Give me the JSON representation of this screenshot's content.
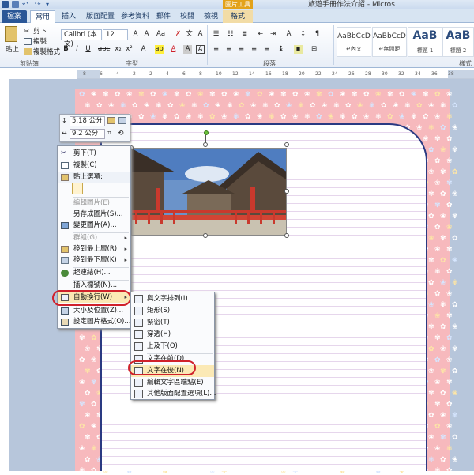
{
  "window": {
    "title": "旅遊手冊作法介紹 - Micros"
  },
  "quick_access": {
    "icons": [
      "word-icon",
      "save-icon",
      "undo-icon",
      "redo-icon",
      "customize-icon"
    ]
  },
  "contextual_tab": {
    "label": "圖片工具"
  },
  "tabs": [
    {
      "label": "檔案"
    },
    {
      "label": "常用"
    },
    {
      "label": "插入"
    },
    {
      "label": "版面配置"
    },
    {
      "label": "參考資料"
    },
    {
      "label": "郵件"
    },
    {
      "label": "校閱"
    },
    {
      "label": "檢視"
    },
    {
      "label": "格式"
    }
  ],
  "ribbon": {
    "clipboard": {
      "paste": "貼上",
      "cut": "剪下",
      "copy": "複製",
      "format_painter": "複製格式",
      "group_label": "剪貼簿"
    },
    "font": {
      "name": "Calibri (本文)",
      "size": "12",
      "group_label": "字型",
      "color_accent": "#d0212b"
    },
    "paragraph": {
      "group_label": "段落"
    },
    "styles": {
      "items": [
        {
          "preview": "AaBbCcD",
          "name": "↵內文"
        },
        {
          "preview": "AaBbCcD",
          "name": "↵無間距"
        },
        {
          "preview": "AaB",
          "name": "標題 1"
        },
        {
          "preview": "AaB",
          "name": "標題 2"
        }
      ],
      "group_label": "樣式"
    }
  },
  "ruler": {
    "marks": [
      "8",
      "6",
      "4",
      "2",
      "2",
      "4",
      "6",
      "8",
      "10",
      "12",
      "14",
      "16",
      "18",
      "20",
      "22",
      "24",
      "26",
      "28",
      "30",
      "32",
      "34",
      "36",
      "38"
    ]
  },
  "mini_toolbar": {
    "height": "5.18 公分",
    "width": "9.2 公分"
  },
  "context_menu": {
    "items": [
      {
        "label": "剪下(T)",
        "icon": "scissors-icon",
        "enabled": true
      },
      {
        "label": "複製(C)",
        "icon": "copy-icon",
        "enabled": true
      },
      {
        "label": "貼上選項:",
        "icon": "paste-icon",
        "enabled": true
      },
      {
        "label": "編輯圖片(E)",
        "icon": "",
        "enabled": false
      },
      {
        "label": "另存成圖片(S)...",
        "icon": "",
        "enabled": true
      },
      {
        "label": "變更圖片(A)...",
        "icon": "change-picture-icon",
        "enabled": true
      },
      {
        "label": "群組(G)",
        "icon": "",
        "enabled": false
      },
      {
        "label": "移到最上層(R)",
        "icon": "bring-front-icon",
        "enabled": true
      },
      {
        "label": "移到最下層(K)",
        "icon": "send-back-icon",
        "enabled": true
      },
      {
        "label": "超連結(H)...",
        "icon": "hyperlink-icon",
        "enabled": true
      },
      {
        "label": "插入標號(N)...",
        "icon": "",
        "enabled": true
      },
      {
        "label": "自動換行(W)",
        "icon": "text-wrap-icon",
        "enabled": true
      },
      {
        "label": "大小及位置(Z)...",
        "icon": "size-position-icon",
        "enabled": true
      },
      {
        "label": "設定圖片格式(O)...",
        "icon": "format-picture-icon",
        "enabled": true
      }
    ]
  },
  "wrap_submenu": {
    "items": [
      {
        "label": "與文字排列(I)"
      },
      {
        "label": "矩形(S)"
      },
      {
        "label": "緊密(T)"
      },
      {
        "label": "穿透(H)"
      },
      {
        "label": "上及下(O)"
      },
      {
        "label": "文字在前(D)"
      },
      {
        "label": "文字在後(N)"
      },
      {
        "label": "編輯文字區端點(E)"
      },
      {
        "label": "其他版面配置選項(L)..."
      }
    ]
  },
  "colors": {
    "page_background": "#f7b9bd",
    "frame": "#2a3a82",
    "highlight": "#d0212b",
    "file_tab": "#2b5797"
  }
}
